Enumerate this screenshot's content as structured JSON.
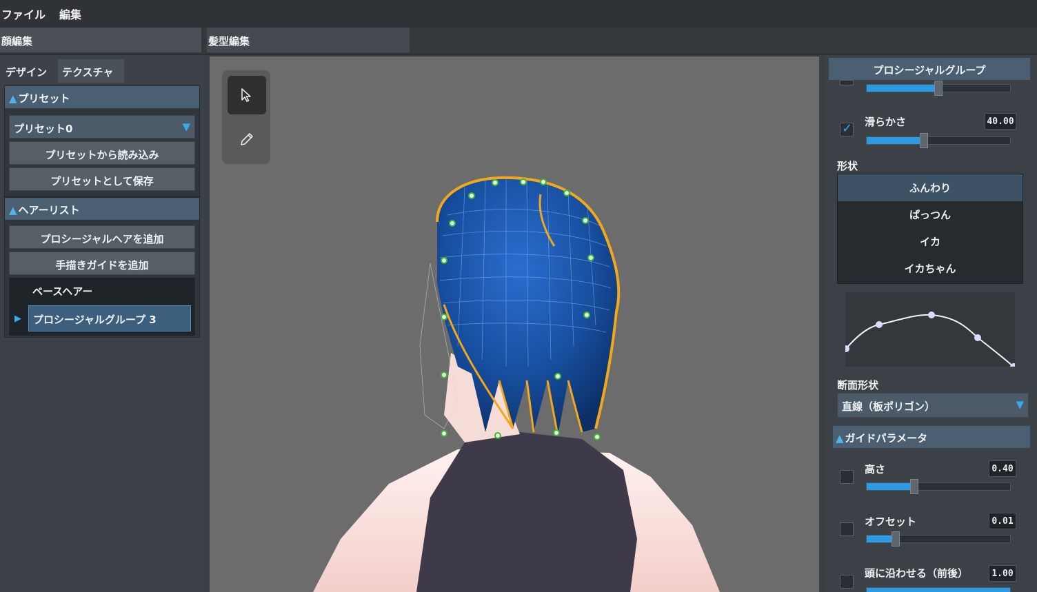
{
  "menu": {
    "file": "ファイル",
    "edit": "編集"
  },
  "mode_tabs": {
    "face": "顔編集",
    "hair": "髪型編集"
  },
  "left": {
    "tabs": {
      "design": "デザイン",
      "texture": "テクスチャ"
    },
    "preset_section": {
      "title": "プリセット",
      "selected": "プリセット0",
      "load_button": "プリセットから読み込み",
      "save_button": "プリセットとして保存"
    },
    "hairlist_section": {
      "title": "ヘアーリスト",
      "add_procedural_button": "プロシージャルヘアを追加",
      "add_handdrawn_button": "手描きガイドを追加",
      "items": [
        {
          "label": "ベースヘアー"
        },
        {
          "label": "プロシージャルグループ 3"
        }
      ],
      "selected_index": 1
    }
  },
  "right": {
    "title": "プロシージャルグループ",
    "top_slider_value": 0.5,
    "smoothness": {
      "label": "滑らかさ",
      "value": "40.00",
      "checked": true,
      "fill": 0.4
    },
    "shape_label": "形状",
    "shape_options": [
      "ふんわり",
      "ぱっつん",
      "イカ",
      "イカちゃん"
    ],
    "shape_selected": "ふんわり",
    "cross_section_label": "断面形状",
    "cross_section_value": "直線（板ポリゴン）",
    "guide_section": {
      "title": "ガイドパラメータ",
      "height": {
        "label": "高さ",
        "value": "0.40",
        "checked": false,
        "fill": 0.33
      },
      "offset": {
        "label": "オフセット",
        "value": "0.01",
        "checked": false,
        "fill": 0.2
      },
      "follow_head": {
        "label": "頭に沿わせる（前後）",
        "value": "1.00",
        "checked": false,
        "fill": 1.0
      }
    }
  },
  "colors": {
    "accent": "#2b9be6",
    "header": "#4b5f72",
    "selection": "#3b5f7d",
    "hair_outline": "#f0a81c",
    "hair_blue": "#1a5fc0",
    "viewport_bg": "#6c6c6c"
  },
  "icons": {
    "select_tool": "cursor-arrow-icon",
    "draw_tool": "pencil-icon"
  }
}
